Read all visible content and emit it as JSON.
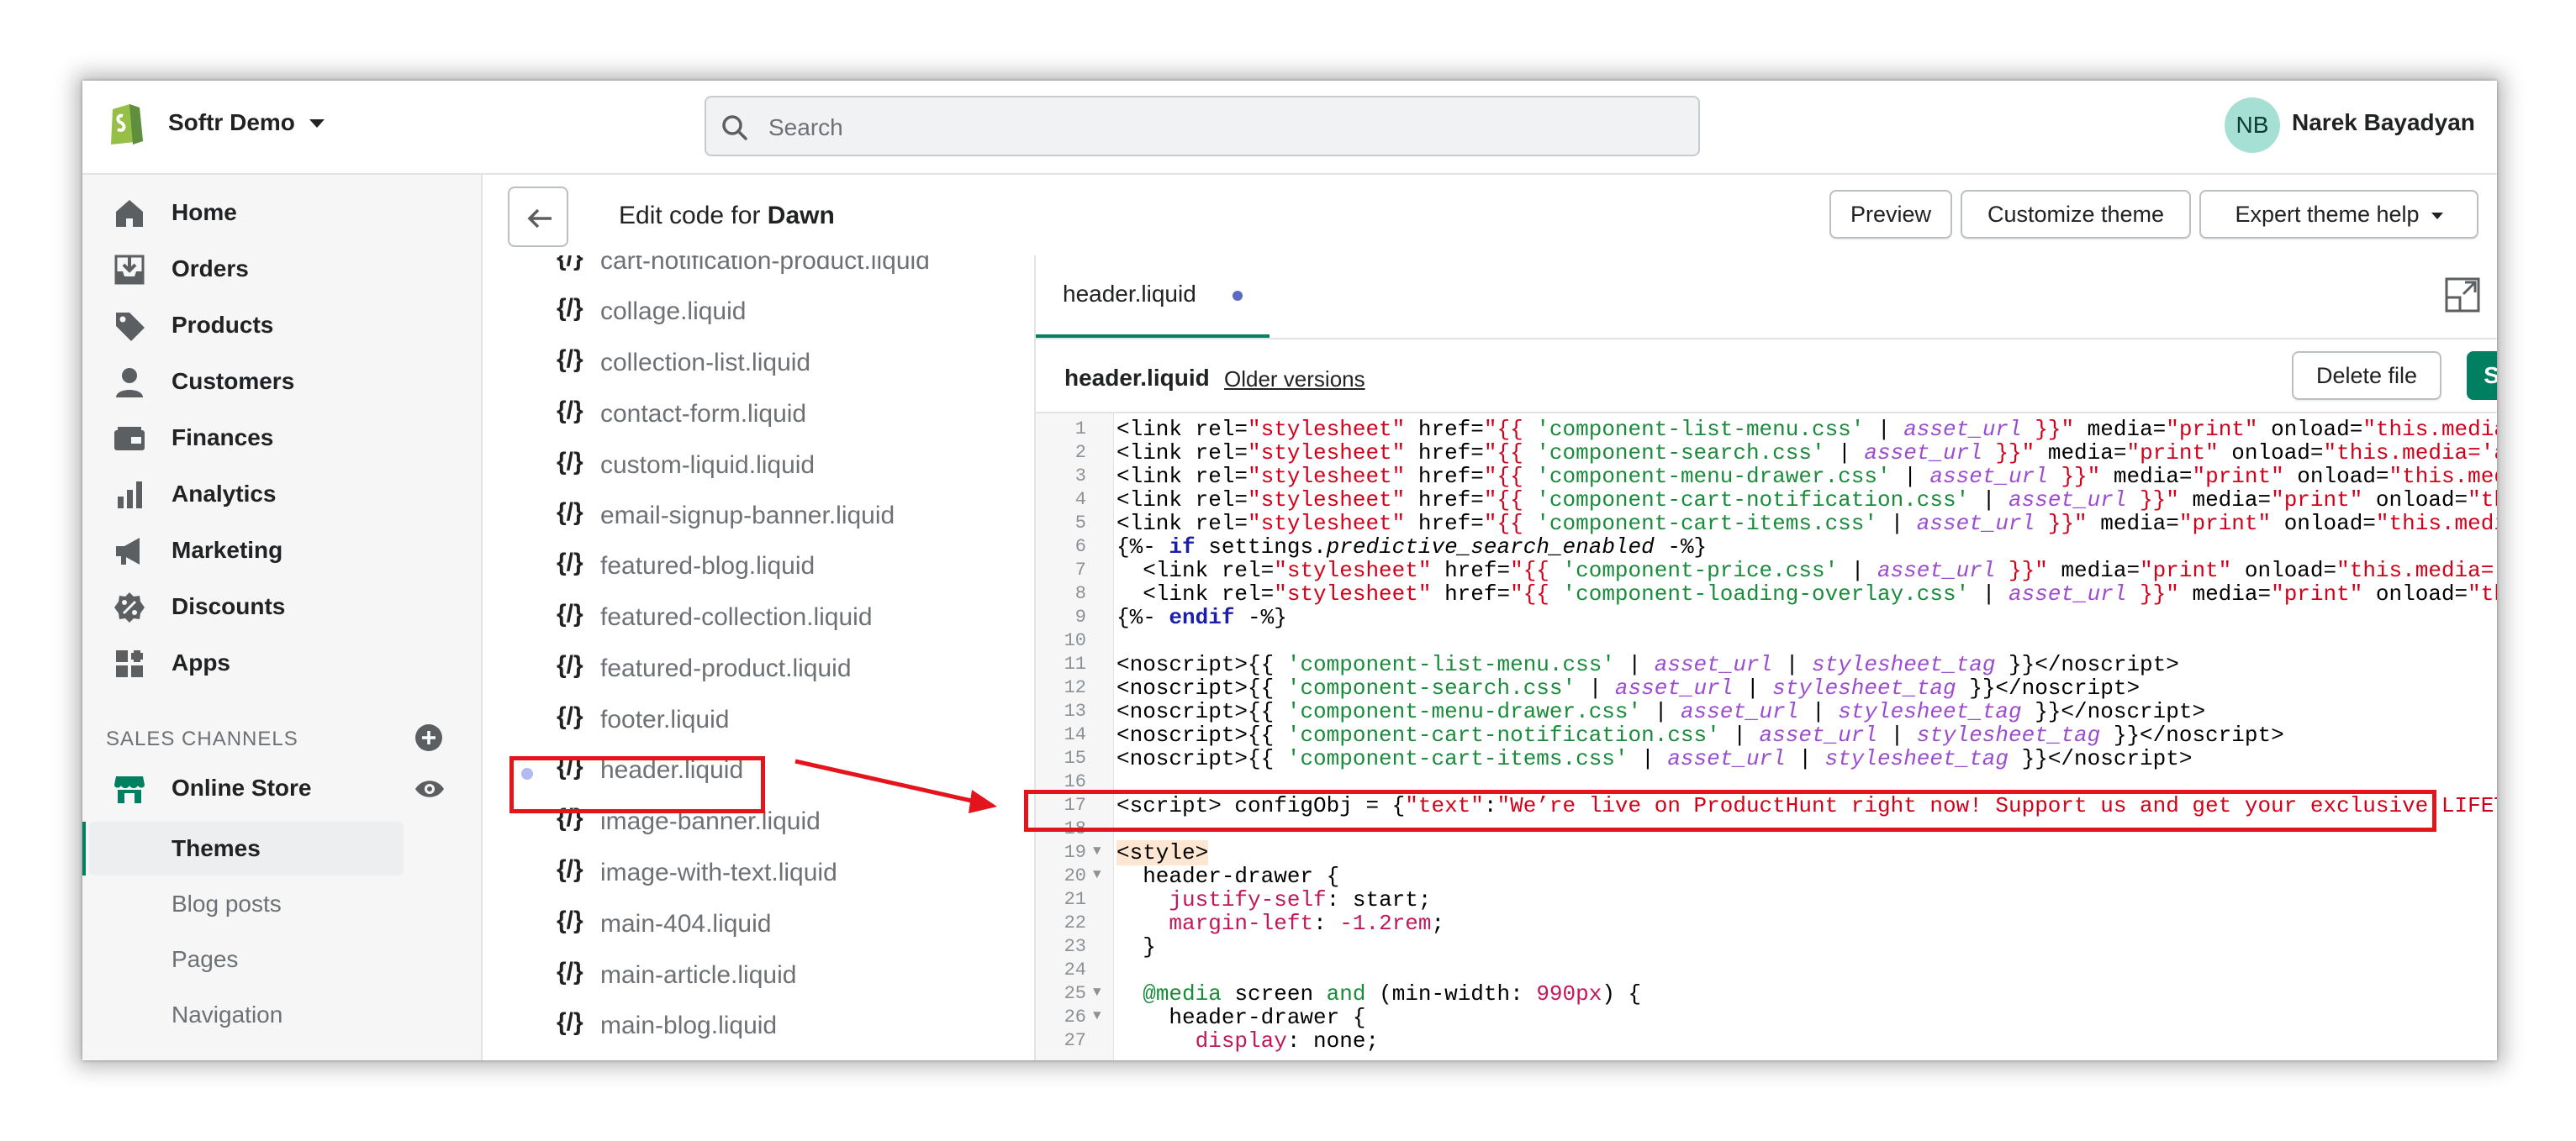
{
  "store": {
    "name": "Softr Demo"
  },
  "search": {
    "placeholder": "Search"
  },
  "user": {
    "initials": "NB",
    "name": "Narek Bayadyan"
  },
  "sidebar": {
    "items": [
      {
        "label": "Home",
        "icon": "home-icon"
      },
      {
        "label": "Orders",
        "icon": "orders-icon"
      },
      {
        "label": "Products",
        "icon": "tag-icon"
      },
      {
        "label": "Customers",
        "icon": "person-icon"
      },
      {
        "label": "Finances",
        "icon": "finances-icon"
      },
      {
        "label": "Analytics",
        "icon": "bar-chart-icon"
      },
      {
        "label": "Marketing",
        "icon": "megaphone-icon"
      },
      {
        "label": "Discounts",
        "icon": "discount-icon"
      },
      {
        "label": "Apps",
        "icon": "apps-icon"
      }
    ],
    "section_title": "SALES CHANNELS",
    "online_store": "Online Store",
    "sub_items": [
      "Themes",
      "Blog posts",
      "Pages",
      "Navigation"
    ]
  },
  "page": {
    "title_prefix": "Edit code for",
    "title_theme": "Dawn",
    "preview": "Preview",
    "customize": "Customize theme",
    "expert": "Expert theme help"
  },
  "files": {
    "icon_text": "{/}",
    "items": [
      "cart-notification-product.liquid",
      "collage.liquid",
      "collection-list.liquid",
      "contact-form.liquid",
      "custom-liquid.liquid",
      "email-signup-banner.liquid",
      "featured-blog.liquid",
      "featured-collection.liquid",
      "featured-product.liquid",
      "footer.liquid",
      "header.liquid",
      "image-banner.liquid",
      "image-with-text.liquid",
      "main-404.liquid",
      "main-article.liquid",
      "main-blog.liquid"
    ]
  },
  "editor": {
    "tab_name": "header.liquid",
    "file_name": "header.liquid",
    "older_versions": "Older versions",
    "delete": "Delete file",
    "save": "Save"
  },
  "code": {
    "line_numbers": [
      "1",
      "2",
      "3",
      "4",
      "5",
      "6",
      "7",
      "8",
      "9",
      "10",
      "11",
      "12",
      "13",
      "14",
      "15",
      "16",
      "17",
      "18",
      "19",
      "20",
      "21",
      "22",
      "23",
      "24",
      "25",
      "26",
      "27"
    ]
  },
  "colors": {
    "accent": "#008060",
    "highlight": "#e3141b",
    "sidebar_bg": "#f6f6f7"
  }
}
